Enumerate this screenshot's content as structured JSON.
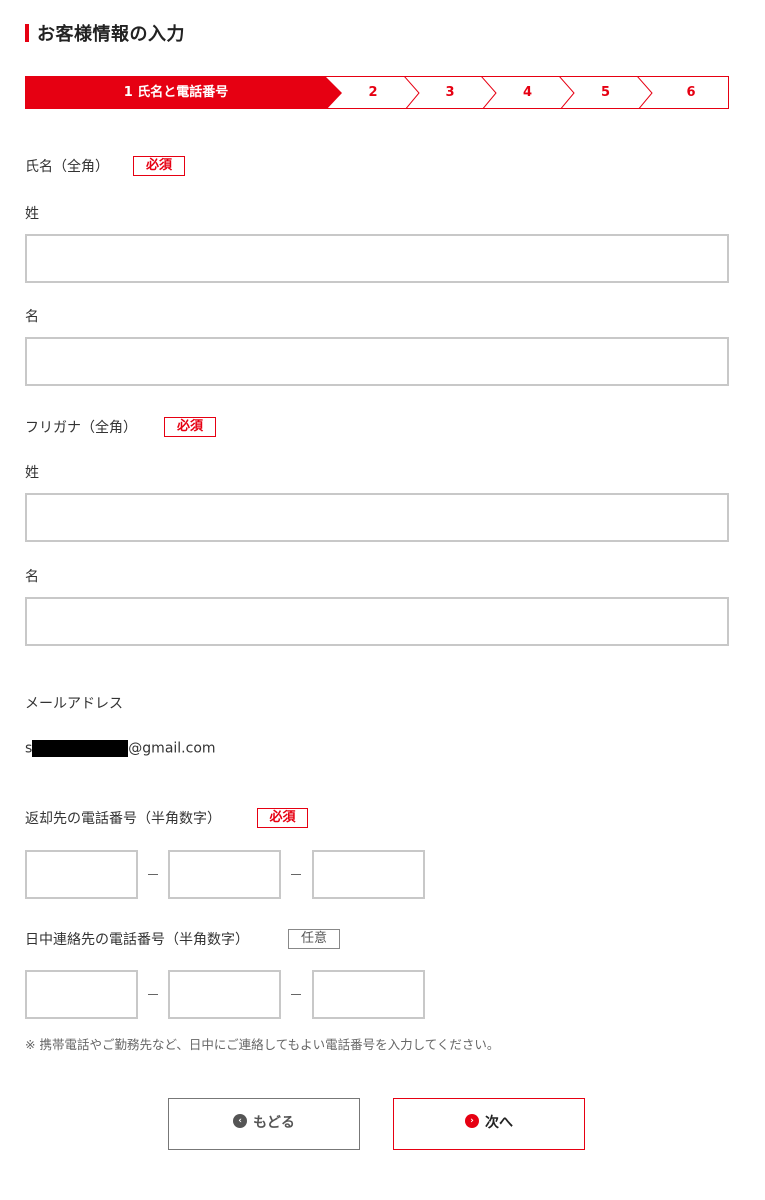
{
  "header": {
    "title": "お客様情報の入力"
  },
  "stepper": {
    "steps": [
      {
        "label": "1 氏名と電話番号"
      },
      {
        "label": "2"
      },
      {
        "label": "3"
      },
      {
        "label": "4"
      },
      {
        "label": "5"
      },
      {
        "label": "6"
      }
    ]
  },
  "name": {
    "label": "氏名（全角）",
    "required": "必須",
    "last_label": "姓",
    "first_label": "名",
    "last_value": "",
    "first_value": ""
  },
  "furigana": {
    "label": "フリガナ（全角）",
    "required": "必須",
    "last_label": "姓",
    "first_label": "名",
    "last_value": "",
    "first_value": ""
  },
  "email": {
    "label": "メールアドレス",
    "prefix": "s",
    "domain": "@gmail.com"
  },
  "return_phone": {
    "label": "返却先の電話番号（半角数字）",
    "required": "必須",
    "separator": "–"
  },
  "day_phone": {
    "label": "日中連絡先の電話番号（半角数字）",
    "optional": "任意",
    "separator": "–"
  },
  "note": "※ 携帯電話やご勤務先など、日中にご連絡してもよい電話番号を入力してください。",
  "buttons": {
    "back": "もどる",
    "next": "次へ"
  },
  "colors": {
    "accent": "#e60012",
    "border": "#c8c8c8"
  }
}
